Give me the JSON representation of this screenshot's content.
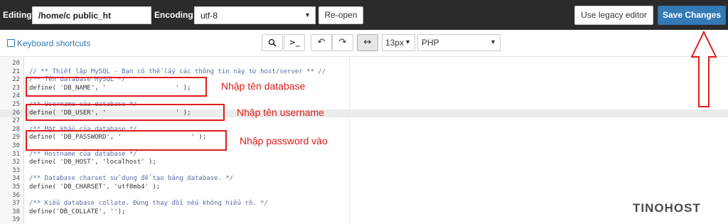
{
  "topbar": {
    "editing_label": "Editing:",
    "path_value": "/home/c            public_ht",
    "encoding_label": "Encoding:",
    "encoding_value": "utf-8",
    "reopen_label": "Re-open",
    "legacy_label": "Use legacy editor",
    "save_label": "Save Changes"
  },
  "toolbar": {
    "keyboard_shortcuts": "Keyboard shortcuts",
    "search_icon": "🔍",
    "terminal_icon": ">_",
    "undo_icon": "↶",
    "redo_icon": "↷",
    "wrap_icon": "↔",
    "font_size": "13px",
    "mode": "PHP"
  },
  "editor": {
    "lines": [
      {
        "n": "20",
        "t": ""
      },
      {
        "n": "21",
        "t": "// ** Thiết lập MySQL - Bạn có thể lấy các thông tin này từ host/server ** //"
      },
      {
        "n": "22",
        "t": "/** Tên database MySQL */"
      },
      {
        "n": "23",
        "t": "define( 'DB_NAME', '                  ' );"
      },
      {
        "n": "24",
        "t": ""
      },
      {
        "n": "25",
        "t": "/** Username của database */"
      },
      {
        "n": "26",
        "t": "define( 'DB_USER', '                  ' );"
      },
      {
        "n": "27",
        "t": ""
      },
      {
        "n": "28",
        "t": "/** Mật khẩu của database */"
      },
      {
        "n": "29",
        "t": "define( 'DB_PASSWORD', '                  ' );"
      },
      {
        "n": "30",
        "t": ""
      },
      {
        "n": "31",
        "t": "/** Hostname của database */"
      },
      {
        "n": "32",
        "t": "define( 'DB_HOST', 'localhost' );"
      },
      {
        "n": "33",
        "t": ""
      },
      {
        "n": "34",
        "t": "/** Database charset sử dụng để tạo bảng database. */"
      },
      {
        "n": "35",
        "t": "define( 'DB_CHARSET', 'utf8mb4' );"
      },
      {
        "n": "36",
        "t": ""
      },
      {
        "n": "37",
        "t": "/** Kiểu database collate. Đừng thay đổi nếu không hiểu rõ. */"
      },
      {
        "n": "38",
        "t": "define('DB_COLLATE', '');"
      },
      {
        "n": "39",
        "t": ""
      }
    ]
  },
  "annotations": {
    "db_name": "Nhập tên database",
    "username": "Nhập tên username",
    "password": "Nhập password vào"
  },
  "logo": "TINOHOST",
  "colors": {
    "topbar": "#2b2b2b",
    "save_button": "#337ab7",
    "annotation": "#e01b1b",
    "link": "#337ab7"
  }
}
